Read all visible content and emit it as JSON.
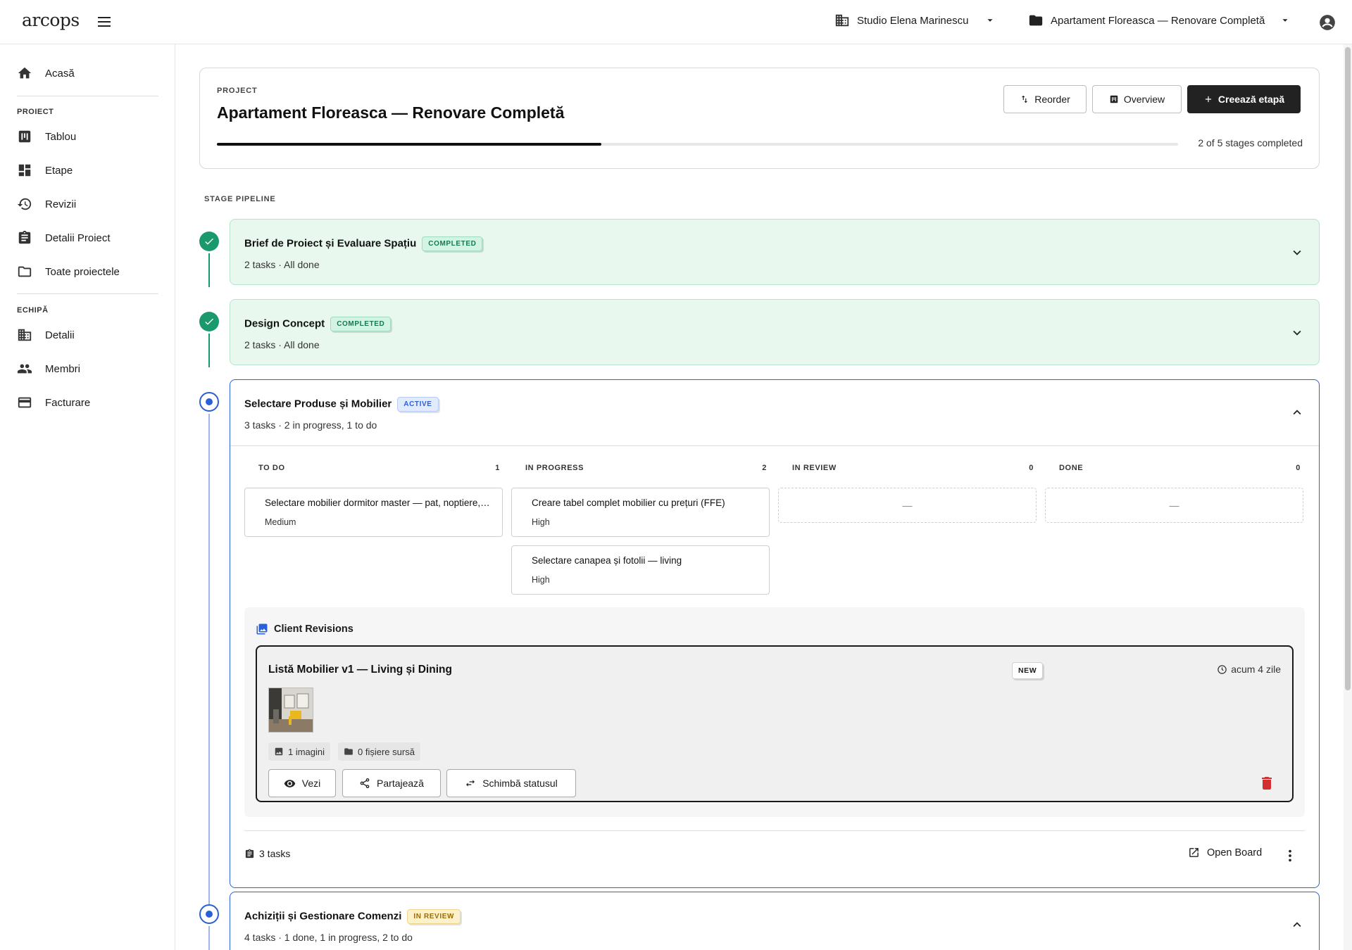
{
  "app": {
    "logo": "arcops",
    "workspace": "Studio Elena Marinescu",
    "project_select": "Apartament Floreasca — Renovare Completă"
  },
  "sidebar": {
    "home": "Acasă",
    "section_project": "PROIECT",
    "project_items": [
      "Tablou",
      "Etape",
      "Revizii",
      "Detalii Proiect",
      "Toate proiectele"
    ],
    "section_team": "ECHIPĂ",
    "team_items": [
      "Detalii",
      "Membri",
      "Facturare"
    ]
  },
  "project": {
    "kicker": "PROJECT",
    "title": "Apartament Floreasca — Renovare Completă",
    "progress_fraction": 0.4,
    "progress_text": "2 of 5 stages completed",
    "buttons": {
      "reorder": "Reorder",
      "overview": "Overview",
      "create": "Creează etapă"
    }
  },
  "pipeline_label": "STAGE PIPELINE",
  "stages": [
    {
      "title": "Brief de Proiect și Evaluare Spațiu",
      "badge": "COMPLETED",
      "subtitle": "2 tasks · All done"
    },
    {
      "title": "Design Concept",
      "badge": "COMPLETED",
      "subtitle": "2 tasks · All done"
    },
    {
      "title": "Selectare Produse și Mobilier",
      "badge": "ACTIVE",
      "subtitle": "3 tasks · 2 in progress, 1 to do"
    },
    {
      "title": "Achiziții și Gestionare Comenzi",
      "badge": "IN REVIEW",
      "subtitle": "4 tasks · 1 done, 1 in progress, 2 to do"
    }
  ],
  "board": {
    "columns": [
      {
        "label": "TO DO",
        "count": "1",
        "tasks": [
          {
            "title": "Selectare mobilier dormitor master — pat, noptiere, dulap",
            "priority": "Medium"
          }
        ]
      },
      {
        "label": "IN PROGRESS",
        "count": "2",
        "tasks": [
          {
            "title": "Creare tabel complet mobilier cu prețuri (FFE)",
            "priority": "High"
          },
          {
            "title": "Selectare canapea și fotolii — living",
            "priority": "High"
          }
        ]
      },
      {
        "label": "IN REVIEW",
        "count": "0",
        "empty": "—"
      },
      {
        "label": "DONE",
        "count": "0",
        "empty": "—"
      }
    ]
  },
  "revisions": {
    "heading": "Client Revisions",
    "card": {
      "title": "Listă Mobilier v1 — Living și Dining",
      "badge": "NEW",
      "time": "acum 4 zile",
      "images_chip": "1 imagini",
      "files_chip": "0 fișiere sursă",
      "view": "Vezi",
      "share": "Partajează",
      "change_status": "Schimbă statusul"
    }
  },
  "stage_footer": {
    "tasks": "3 tasks",
    "open_board": "Open Board"
  },
  "colors": {
    "completed_bg": "#e8f8ef",
    "completed_dot": "#1a9a6c",
    "active_accent": "#2b5fd6",
    "delete": "#d32f2f"
  }
}
